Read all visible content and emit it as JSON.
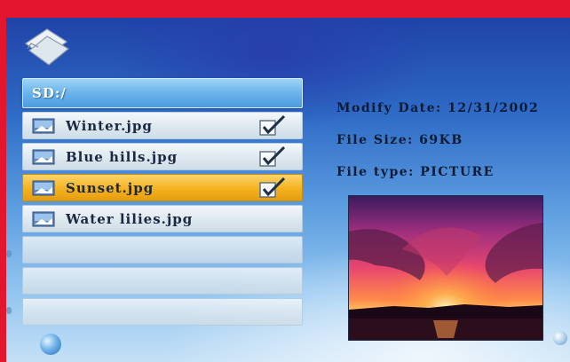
{
  "path": "SD:/",
  "files": [
    {
      "name": "Winter.jpg",
      "checked": true,
      "selected": false
    },
    {
      "name": "Blue hills.jpg",
      "checked": true,
      "selected": false
    },
    {
      "name": "Sunset.jpg",
      "checked": true,
      "selected": true
    },
    {
      "name": "Water lilies.jpg",
      "checked": false,
      "selected": false
    }
  ],
  "info": {
    "modify_date": "Modify Date: 12/31/2002",
    "file_size": "File Size: 69KB",
    "file_type": "File type: PICTURE"
  },
  "colors": {
    "selection": "#f4b21f",
    "path_bar": "#6ab3ea"
  }
}
